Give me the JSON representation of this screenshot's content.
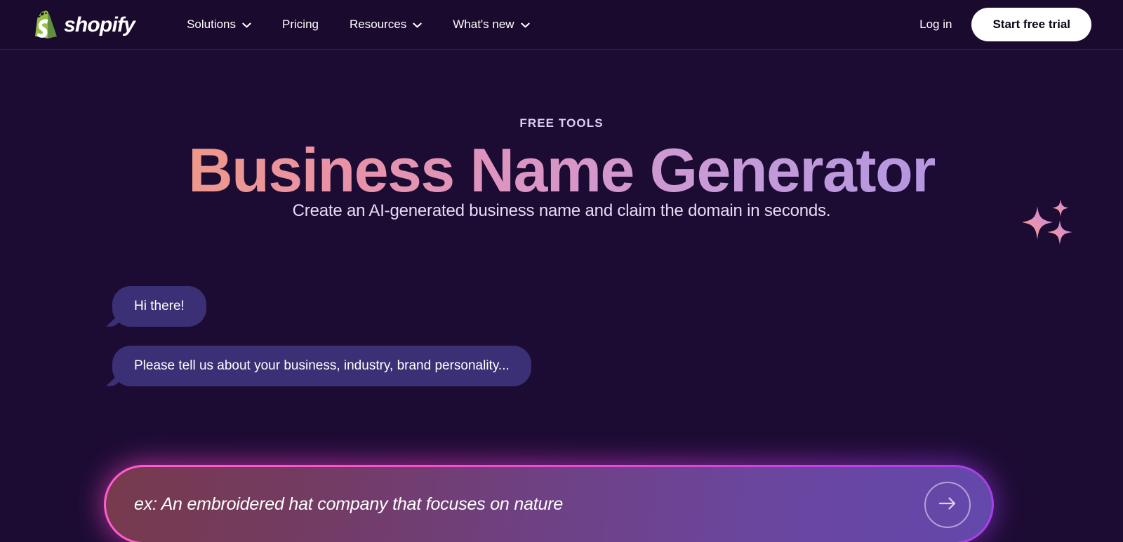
{
  "theme": {
    "page_background": "#1c0b33",
    "navbar_background": "#1a0a2e",
    "brand_green": "#95bf47",
    "bubble_background": "#3b3075",
    "accent_pink": "#ff4fc9",
    "accent_purple": "#a63fe6",
    "title_gradient_start": "#f4a06a",
    "title_gradient_end": "#a78ee2"
  },
  "navbar": {
    "brand": {
      "logo_icon": "shopify-bag-icon",
      "wordmark": "shopify"
    },
    "links": [
      {
        "label": "Solutions",
        "has_dropdown": true,
        "icon": "chevron-down-icon"
      },
      {
        "label": "Pricing",
        "has_dropdown": false,
        "icon": ""
      },
      {
        "label": "Resources",
        "has_dropdown": true,
        "icon": "chevron-down-icon"
      },
      {
        "label": "What's new",
        "has_dropdown": true,
        "icon": "chevron-down-icon"
      }
    ],
    "login_label": "Log in",
    "trial_label": "Start free trial"
  },
  "hero": {
    "eyebrow": "FREE TOOLS",
    "title": "Business Name Generator",
    "subtitle": "Create an AI-generated business name and claim the domain in seconds.",
    "decoration_icon": "sparkles-icon"
  },
  "chat": {
    "messages": [
      {
        "text": "Hi there!",
        "sender": "assistant"
      },
      {
        "text": "Please tell us about your business, industry, brand personality...",
        "sender": "assistant"
      }
    ]
  },
  "prompt": {
    "value": "",
    "placeholder": "ex: An embroidered hat company that focuses on nature",
    "submit_icon": "arrow-right-icon",
    "submit_label": "Submit"
  }
}
